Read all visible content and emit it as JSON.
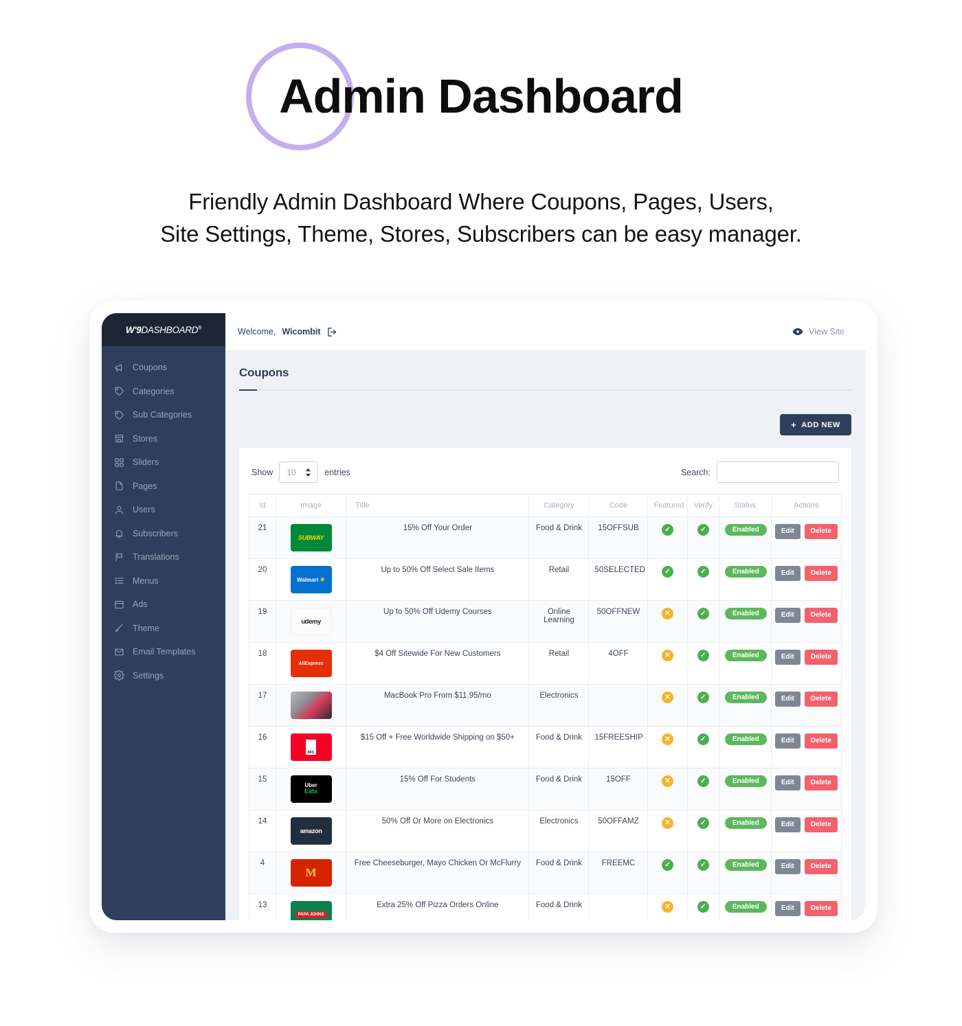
{
  "hero": {
    "title": "Admin Dashboard",
    "subtitle_line1": "Friendly Admin Dashboard Where Coupons, Pages, Users,",
    "subtitle_line2": "Site Settings, Theme, Stores, Subscribers can be easy manager.",
    "ring_color": "#c3aef0"
  },
  "brand": {
    "prefix": "W'9",
    "suffix": "DASHBOARD",
    "registered": "®"
  },
  "sidebar": {
    "bg": "#2e3e5c",
    "items": [
      {
        "label": "Coupons",
        "icon": "megaphone-icon"
      },
      {
        "label": "Categories",
        "icon": "tag-icon"
      },
      {
        "label": "Sub Categories",
        "icon": "tag-icon"
      },
      {
        "label": "Stores",
        "icon": "store-icon"
      },
      {
        "label": "Sliders",
        "icon": "grid-icon"
      },
      {
        "label": "Pages",
        "icon": "file-icon"
      },
      {
        "label": "Users",
        "icon": "user-icon"
      },
      {
        "label": "Subscribers",
        "icon": "bell-icon"
      },
      {
        "label": "Translations",
        "icon": "flag-icon"
      },
      {
        "label": "Menus",
        "icon": "list-icon"
      },
      {
        "label": "Ads",
        "icon": "window-icon"
      },
      {
        "label": "Theme",
        "icon": "brush-icon"
      },
      {
        "label": "Email Templates",
        "icon": "envelope-icon"
      },
      {
        "label": "Settings",
        "icon": "gear-icon"
      }
    ]
  },
  "topbar": {
    "welcome_prefix": "Welcome,",
    "user": "Wicombit",
    "view_site": "View Site"
  },
  "page": {
    "title": "Coupons",
    "add_new": "ADD NEW",
    "add_new_plus": "+"
  },
  "controls": {
    "show_label": "Show",
    "entries_label": "entries",
    "page_size": "10",
    "search_label": "Search:",
    "search_value": "",
    "search_placeholder": ""
  },
  "table": {
    "columns": [
      "Id",
      "Image",
      "Title",
      "Category",
      "Code",
      "Featured",
      "Verify",
      "Status",
      "Actions"
    ],
    "edit_label": "Edit",
    "delete_label": "Delete",
    "rows": [
      {
        "id": "21",
        "logo": "subway-logo",
        "logo_text": "SUBWAY",
        "title": "15% Off Your Order",
        "category": "Food & Drink",
        "code": "15OFFSUB",
        "featured": "yes",
        "verify": "yes",
        "status": "Enabled"
      },
      {
        "id": "20",
        "logo": "walmart-logo",
        "logo_text": "Walmart",
        "title": "Up to 50% Off Select Sale Items",
        "category": "Retail",
        "code": "50SELECTED",
        "featured": "yes",
        "verify": "yes",
        "status": "Enabled"
      },
      {
        "id": "19",
        "logo": "udemy-logo",
        "logo_text": "udemy",
        "title": "Up to 50% Off Udemy Courses",
        "category": "Online Learning",
        "code": "50OFFNEW",
        "featured": "no",
        "verify": "yes",
        "status": "Enabled"
      },
      {
        "id": "18",
        "logo": "aliexpress-logo",
        "logo_text": "AliExpress",
        "title": "$4 Off Sitewide For New Customers",
        "category": "Retail",
        "code": "4OFF",
        "featured": "no",
        "verify": "yes",
        "status": "Enabled"
      },
      {
        "id": "17",
        "logo": "macbook-photo",
        "logo_text": "",
        "title": "MacBook Pro From $11.95/mo",
        "category": "Electronics",
        "code": "",
        "featured": "no",
        "verify": "yes",
        "status": "Enabled"
      },
      {
        "id": "16",
        "logo": "kfc-logo",
        "logo_text": "KFC",
        "title": "$15 Off + Free Worldwide Shipping on $50+",
        "category": "Food & Drink",
        "code": "15FREESHIP",
        "featured": "no",
        "verify": "yes",
        "status": "Enabled"
      },
      {
        "id": "15",
        "logo": "ubereats-logo",
        "logo_text": "Uber Eats",
        "title": "15% Off For Students",
        "category": "Food & Drink",
        "code": "15OFF",
        "featured": "no",
        "verify": "yes",
        "status": "Enabled"
      },
      {
        "id": "14",
        "logo": "amazon-logo",
        "logo_text": "amazon",
        "title": "50% Off Or More on Electronics",
        "category": "Electronics",
        "code": "50OFFAMZ",
        "featured": "no",
        "verify": "yes",
        "status": "Enabled"
      },
      {
        "id": "4",
        "logo": "mcdonalds-logo",
        "logo_text": "M",
        "title": "Free Cheeseburger, Mayo Chicken Or McFlurry",
        "category": "Food & Drink",
        "code": "FREEMC",
        "featured": "yes",
        "verify": "yes",
        "status": "Enabled"
      },
      {
        "id": "13",
        "logo": "papajohns-logo",
        "logo_text": "PAPA JOHNS",
        "title": "Extra 25% Off Pizza Orders Online",
        "category": "Food & Drink",
        "code": "",
        "featured": "no",
        "verify": "yes",
        "status": "Enabled"
      }
    ]
  },
  "colors": {
    "accent_dark": "#2e3e5c",
    "green": "#4caf50",
    "amber": "#f7b32b",
    "red": "#f4606c",
    "gray": "#7f8794"
  }
}
